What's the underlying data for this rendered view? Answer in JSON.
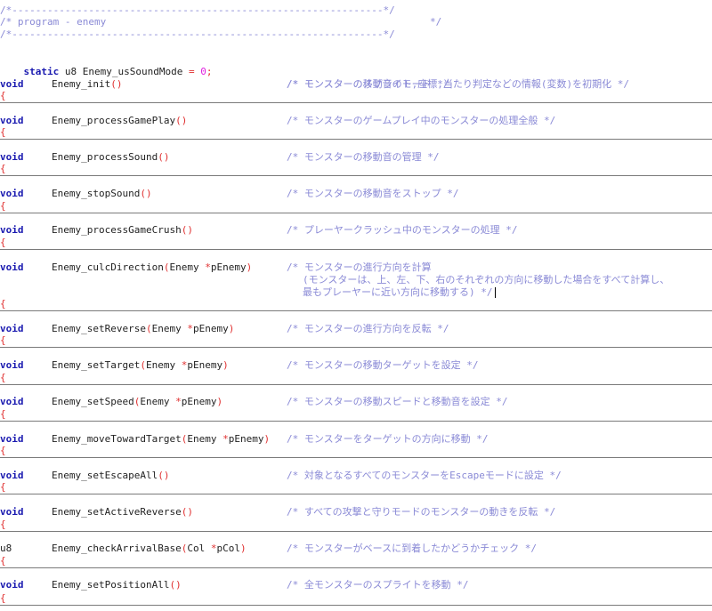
{
  "header": {
    "line1": "/*---------------------------------------------------------------*/",
    "line2_open": "/* program - enemy",
    "line2_close": "*/",
    "line3": "/*---------------------------------------------------------------*/"
  },
  "static_decl": {
    "kw": "static",
    "type": "u8",
    "name": "Enemy_usSoundMode",
    "eq": "=",
    "value": "0",
    "semi": ";",
    "comment": "/* モンスターの移動音のモード */"
  },
  "brace": "{",
  "functions": [
    {
      "ret": "void",
      "name": "Enemy_init",
      "args_open": "(",
      "args_type": "",
      "args_star": "",
      "args_name": "",
      "args_close": ")",
      "comment": "/* モンスターのスプライト,座標,当たり判定などの情報(変数)を初期化 */"
    },
    {
      "ret": "void",
      "name": "Enemy_processGamePlay",
      "args_open": "(",
      "args_type": "",
      "args_star": "",
      "args_name": "",
      "args_close": ")",
      "comment": "/* モンスターのゲームプレイ中のモンスターの処理全般 */"
    },
    {
      "ret": "void",
      "name": "Enemy_processSound",
      "args_open": "(",
      "args_type": "",
      "args_star": "",
      "args_name": "",
      "args_close": ")",
      "comment": "/* モンスターの移動音の管理 */"
    },
    {
      "ret": "void",
      "name": "Enemy_stopSound",
      "args_open": "(",
      "args_type": "",
      "args_star": "",
      "args_name": "",
      "args_close": ")",
      "comment": "/* モンスターの移動音をストップ */"
    },
    {
      "ret": "void",
      "name": "Enemy_processGameCrush",
      "args_open": "(",
      "args_type": "",
      "args_star": "",
      "args_name": "",
      "args_close": ")",
      "comment": "/* プレーヤークラッシュ中のモンスターの処理 */"
    },
    {
      "ret": "void",
      "name": "Enemy_culcDirection",
      "args_open": "(",
      "args_type": "Enemy ",
      "args_star": "*",
      "args_name": "pEnemy",
      "args_close": ")",
      "comment": "/* モンスターの進行方向を計算",
      "comment2": "(モンスターは、上、左、下、右のそれぞれの方向に移動した場合をすべて計算し、",
      "comment3": "最もプレーヤーに近い方向に移動する) */"
    },
    {
      "ret": "void",
      "name": "Enemy_setReverse",
      "args_open": "(",
      "args_type": "Enemy ",
      "args_star": "*",
      "args_name": "pEnemy",
      "args_close": ")",
      "comment": "/* モンスターの進行方向を反転 */"
    },
    {
      "ret": "void",
      "name": "Enemy_setTarget",
      "args_open": "(",
      "args_type": "Enemy ",
      "args_star": "*",
      "args_name": "pEnemy",
      "args_close": ")",
      "comment": "/* モンスターの移動ターゲットを設定 */"
    },
    {
      "ret": "void",
      "name": "Enemy_setSpeed",
      "args_open": "(",
      "args_type": "Enemy ",
      "args_star": "*",
      "args_name": "pEnemy",
      "args_close": ")",
      "comment": "/* モンスターの移動スピードと移動音を設定 */"
    },
    {
      "ret": "void",
      "name": "Enemy_moveTowardTarget",
      "args_open": "(",
      "args_type": "Enemy ",
      "args_star": "*",
      "args_name": "pEnemy",
      "args_close": ")",
      "comment": "/* モンスターをターゲットの方向に移動 */"
    },
    {
      "ret": "void",
      "name": "Enemy_setEscapeAll",
      "args_open": "(",
      "args_type": "",
      "args_star": "",
      "args_name": "",
      "args_close": ")",
      "comment": "/* 対象となるすべてのモンスターをEscapeモードに設定 */"
    },
    {
      "ret": "void",
      "name": "Enemy_setActiveReverse",
      "args_open": "(",
      "args_type": "",
      "args_star": "",
      "args_name": "",
      "args_close": ")",
      "comment": "/* すべての攻撃と守りモードのモンスターの動きを反転 */"
    },
    {
      "ret": "u8",
      "name": "Enemy_checkArrivalBase",
      "args_open": "(",
      "args_type": "Col ",
      "args_star": "*",
      "args_name": "pCol",
      "args_close": ")",
      "comment": "/* モンスターがベースに到着したかどうかチェック */"
    },
    {
      "ret": "void",
      "name": "Enemy_setPositionAll",
      "args_open": "(",
      "args_type": "",
      "args_star": "",
      "args_name": "",
      "args_close": ")",
      "comment": "/* 全モンスターのスプライトを移動 */"
    }
  ],
  "colors": {
    "keyword": "#1a1ab0",
    "comment": "#8a8ad6",
    "paren": "#e03030",
    "number": "#e020e0",
    "separator": "#7a7a7a"
  }
}
